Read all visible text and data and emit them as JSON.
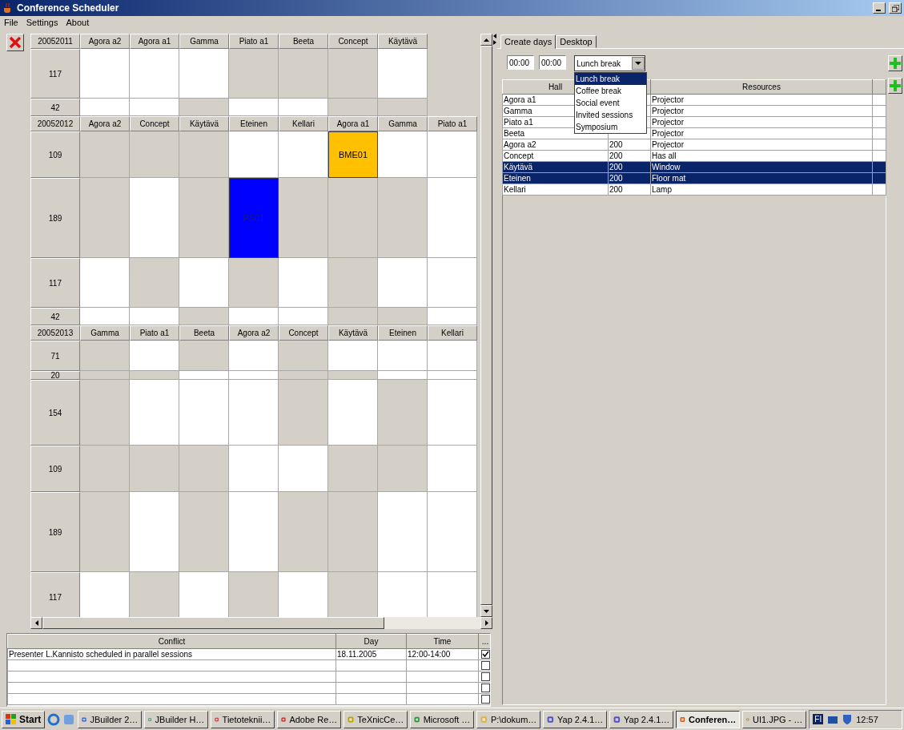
{
  "window": {
    "title": "Conference Scheduler"
  },
  "menu": [
    "File",
    "Settings",
    "About"
  ],
  "schedule": {
    "days": [
      {
        "date": "20052011",
        "halls": [
          "Agora a2",
          "Agora a1",
          "Gamma",
          "Piato a1",
          "Beeta",
          "Concept",
          "Käytävä"
        ],
        "slots": [
          {
            "minutes": "117",
            "cells": [
              {
                "kind": "free"
              },
              {
                "kind": "free"
              },
              {
                "kind": "free"
              },
              {
                "kind": "busy"
              },
              {
                "kind": "busy"
              },
              {
                "kind": "busy"
              },
              {
                "kind": "free"
              }
            ]
          },
          {
            "minutes": "42",
            "cells": [
              {
                "kind": "free"
              },
              {
                "kind": "free"
              },
              {
                "kind": "busy"
              },
              {
                "kind": "free"
              },
              {
                "kind": "free"
              },
              {
                "kind": "busy"
              },
              {
                "kind": "busy"
              }
            ]
          }
        ]
      },
      {
        "date": "20052012",
        "halls": [
          "Agora a2",
          "Concept",
          "Käytävä",
          "Eteinen",
          "Kellari",
          "Agora a1",
          "Gamma",
          "Piato a1"
        ],
        "slots": [
          {
            "minutes": "109",
            "cells": [
              {
                "kind": "busy"
              },
              {
                "kind": "busy"
              },
              {
                "kind": "busy"
              },
              {
                "kind": "free"
              },
              {
                "kind": "free"
              },
              {
                "kind": "event",
                "label": "BME01",
                "color": "#ffc000"
              },
              {
                "kind": "free"
              },
              {
                "kind": "free"
              }
            ]
          },
          {
            "minutes": "189",
            "cells": [
              {
                "kind": "busy"
              },
              {
                "kind": "free"
              },
              {
                "kind": "busy"
              },
              {
                "kind": "event",
                "label": "PS01",
                "color": "#0000ff"
              },
              {
                "kind": "busy"
              },
              {
                "kind": "busy"
              },
              {
                "kind": "busy"
              },
              {
                "kind": "free"
              }
            ]
          },
          {
            "minutes": "117",
            "cells": [
              {
                "kind": "free"
              },
              {
                "kind": "busy"
              },
              {
                "kind": "free"
              },
              {
                "kind": "busy"
              },
              {
                "kind": "free"
              },
              {
                "kind": "busy"
              },
              {
                "kind": "free"
              },
              {
                "kind": "free"
              }
            ]
          },
          {
            "minutes": "42",
            "cells": [
              {
                "kind": "free"
              },
              {
                "kind": "free"
              },
              {
                "kind": "busy"
              },
              {
                "kind": "free"
              },
              {
                "kind": "free"
              },
              {
                "kind": "busy"
              },
              {
                "kind": "busy"
              },
              {
                "kind": "free"
              }
            ]
          }
        ]
      },
      {
        "date": "20052013",
        "halls": [
          "Gamma",
          "Piato a1",
          "Beeta",
          "Agora a2",
          "Concept",
          "Käytävä",
          "Eteinen",
          "Kellari"
        ],
        "slots": [
          {
            "minutes": "71",
            "cells": [
              {
                "kind": "busy"
              },
              {
                "kind": "free"
              },
              {
                "kind": "busy"
              },
              {
                "kind": "free"
              },
              {
                "kind": "busy"
              },
              {
                "kind": "free"
              },
              {
                "kind": "free"
              },
              {
                "kind": "free"
              }
            ]
          },
          {
            "minutes": "20",
            "cells": [
              {
                "kind": "busy"
              },
              {
                "kind": "busy"
              },
              {
                "kind": "free"
              },
              {
                "kind": "free"
              },
              {
                "kind": "busy"
              },
              {
                "kind": "busy"
              },
              {
                "kind": "free"
              },
              {
                "kind": "free"
              }
            ]
          },
          {
            "minutes": "154",
            "cells": [
              {
                "kind": "busy"
              },
              {
                "kind": "free"
              },
              {
                "kind": "free"
              },
              {
                "kind": "free"
              },
              {
                "kind": "busy"
              },
              {
                "kind": "free"
              },
              {
                "kind": "busy"
              },
              {
                "kind": "free"
              }
            ]
          },
          {
            "minutes": "109",
            "cells": [
              {
                "kind": "busy"
              },
              {
                "kind": "busy"
              },
              {
                "kind": "busy"
              },
              {
                "kind": "free"
              },
              {
                "kind": "free"
              },
              {
                "kind": "busy"
              },
              {
                "kind": "busy"
              },
              {
                "kind": "free"
              }
            ]
          },
          {
            "minutes": "189",
            "cells": [
              {
                "kind": "busy"
              },
              {
                "kind": "free"
              },
              {
                "kind": "busy"
              },
              {
                "kind": "free"
              },
              {
                "kind": "busy"
              },
              {
                "kind": "busy"
              },
              {
                "kind": "free"
              },
              {
                "kind": "free"
              }
            ]
          },
          {
            "minutes": "117",
            "cells": [
              {
                "kind": "free"
              },
              {
                "kind": "busy"
              },
              {
                "kind": "free"
              },
              {
                "kind": "busy"
              },
              {
                "kind": "free"
              },
              {
                "kind": "busy"
              },
              {
                "kind": "free"
              },
              {
                "kind": "free"
              }
            ]
          }
        ]
      }
    ]
  },
  "conflicts": {
    "columns": [
      "Conflict",
      "Day",
      "Time",
      "..."
    ],
    "rows": [
      {
        "conflict": "Presenter L.Kannisto scheduled in parallel sessions",
        "day": "18.11.2005",
        "time": "12:00-14:00",
        "checked": true
      },
      {
        "checked": false
      },
      {
        "checked": false
      },
      {
        "checked": false
      },
      {
        "checked": false
      }
    ]
  },
  "tabs": [
    {
      "label": "Create days",
      "selected": true
    },
    {
      "label": "Desktop",
      "selected": false
    }
  ],
  "break_form": {
    "start": "00:00",
    "end": "00:00",
    "type": {
      "value": "Lunch break",
      "expanded": true,
      "options": [
        {
          "label": "Lunch break",
          "selected": true
        },
        {
          "label": "Coffee break",
          "selected": false
        },
        {
          "label": "Social event",
          "selected": false
        },
        {
          "label": "Invited sessions",
          "selected": false
        },
        {
          "label": "Symposium",
          "selected": false
        }
      ]
    }
  },
  "halls_table": {
    "columns": {
      "hall": "Hall",
      "resources": "Resources"
    },
    "rows": [
      {
        "hall": "Agora a1",
        "resources": "Projector",
        "selected": false
      },
      {
        "hall": "Gamma",
        "resources": "Projector",
        "selected": false
      },
      {
        "hall": "Piato a1",
        "resources": "Projector",
        "selected": false
      },
      {
        "hall": "Beeta",
        "resources": "Projector",
        "selected": false
      },
      {
        "hall": "Agora a2",
        "column_2": "200",
        "resources": "Projector",
        "selected": false
      },
      {
        "hall": "Concept",
        "column_2": "200",
        "resources": "Has all",
        "selected": false
      },
      {
        "hall": "Käytävä",
        "column_2": "200",
        "resources": "Window",
        "selected": true
      },
      {
        "hall": "Eteinen",
        "column_2": "200",
        "resources": "Floor mat",
        "selected": true
      },
      {
        "hall": "Kellari",
        "column_2": "200",
        "resources": "Lamp",
        "selected": false
      }
    ]
  },
  "taskbar": {
    "start": "Start",
    "tasks": [
      {
        "label": "JBuilder 2…",
        "selected": false
      },
      {
        "label": "JBuilder H…",
        "selected": false
      },
      {
        "label": "Tietoteknii…",
        "selected": false
      },
      {
        "label": "Adobe Re…",
        "selected": false
      },
      {
        "label": "TeXnicCe…",
        "selected": false
      },
      {
        "label": "Microsoft …",
        "selected": false
      },
      {
        "label": "P:\\dokum…",
        "selected": false
      },
      {
        "label": "Yap 2.4.1…",
        "selected": false
      },
      {
        "label": "Yap 2.4.1…",
        "selected": false
      },
      {
        "label": "Conferen…",
        "selected": true
      },
      {
        "label": "UI1.JPG - …",
        "selected": false
      }
    ],
    "language": "FI",
    "clock": "12:57"
  }
}
